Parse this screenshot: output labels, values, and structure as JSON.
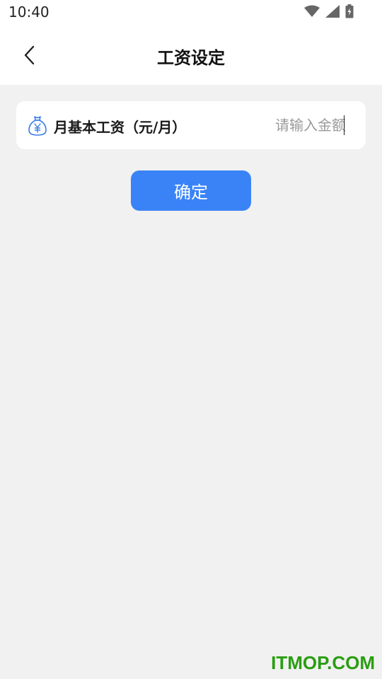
{
  "status_bar": {
    "time": "10:40",
    "icons": [
      "wifi-icon",
      "signal-icon",
      "battery-icon"
    ]
  },
  "header": {
    "back_icon": "chevron-left-icon",
    "title": "工资设定"
  },
  "salary_field": {
    "icon": "money-bag-icon",
    "label": "月基本工资（元/月）",
    "value": "",
    "placeholder": "请输入金额"
  },
  "confirm_button": {
    "label": "确定"
  },
  "watermark": {
    "text": "ITMOP.COM"
  },
  "colors": {
    "accent": "#3a83f7",
    "background": "#f1f1f1",
    "card": "#ffffff",
    "watermark": "#2a9d12"
  }
}
